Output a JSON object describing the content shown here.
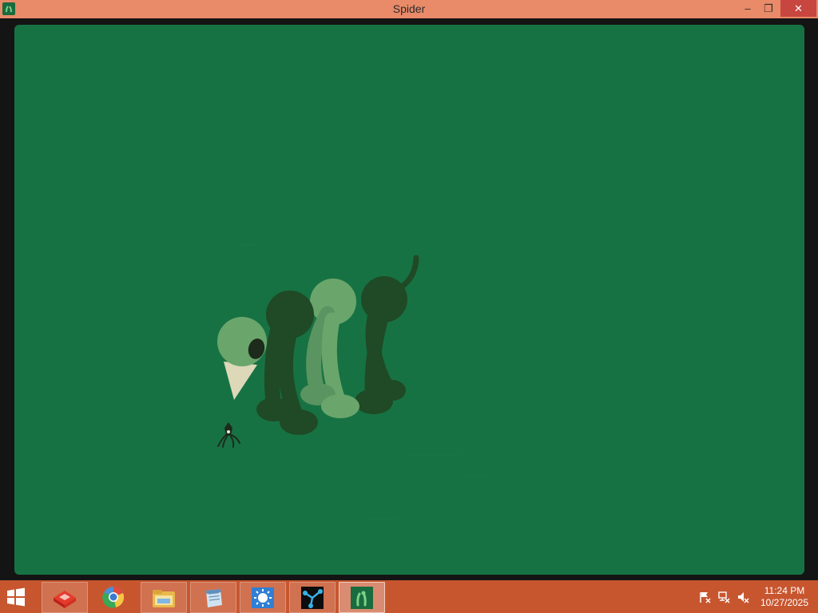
{
  "window": {
    "title": "Spider",
    "minimize_label": "–",
    "restore_label": "❐",
    "close_label": "✕"
  },
  "taskbar": {
    "items": [
      {
        "name": "game-app-icon"
      },
      {
        "name": "browser-icon"
      },
      {
        "name": "file-explorer-icon"
      },
      {
        "name": "notepad-icon"
      },
      {
        "name": "paint-icon"
      },
      {
        "name": "graph-app-icon"
      },
      {
        "name": "spider-app-icon"
      }
    ],
    "tray": {
      "icons": [
        "flag-icon",
        "network-icon",
        "speaker-muted-icon"
      ],
      "time": "11:24 PM",
      "date": "10/27/2025"
    }
  },
  "colors": {
    "titlebar": "#e98a68",
    "game_bg": "#177243",
    "taskbar": "#c7562f",
    "creature_dark": "#1f4a25",
    "creature_light": "#6aa66c",
    "beak": "#dcd8b8"
  }
}
